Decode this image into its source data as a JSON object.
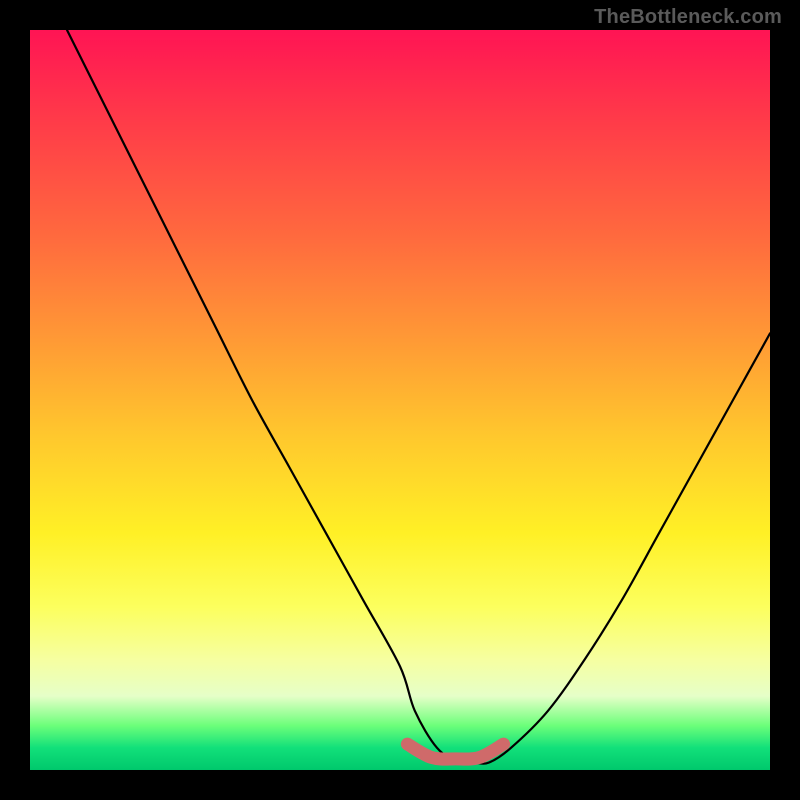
{
  "watermark": "TheBottleneck.com",
  "chart_data": {
    "type": "line",
    "title": "",
    "xlabel": "",
    "ylabel": "",
    "xlim": [
      0,
      100
    ],
    "ylim": [
      0,
      100
    ],
    "grid": false,
    "legend": false,
    "series": [
      {
        "name": "curve",
        "color": "#000000",
        "x": [
          5,
          10,
          15,
          20,
          25,
          30,
          35,
          40,
          45,
          50,
          52,
          55,
          58,
          60,
          62,
          65,
          70,
          75,
          80,
          85,
          90,
          95,
          100
        ],
        "values": [
          100,
          90,
          80,
          70,
          60,
          50,
          41,
          32,
          23,
          14,
          8,
          3,
          1,
          1,
          1,
          3,
          8,
          15,
          23,
          32,
          41,
          50,
          59
        ]
      }
    ],
    "annotations": {
      "trough_band": {
        "color": "#cf6a6a",
        "x_start": 51,
        "x_end": 64,
        "y": 1.5
      }
    }
  }
}
